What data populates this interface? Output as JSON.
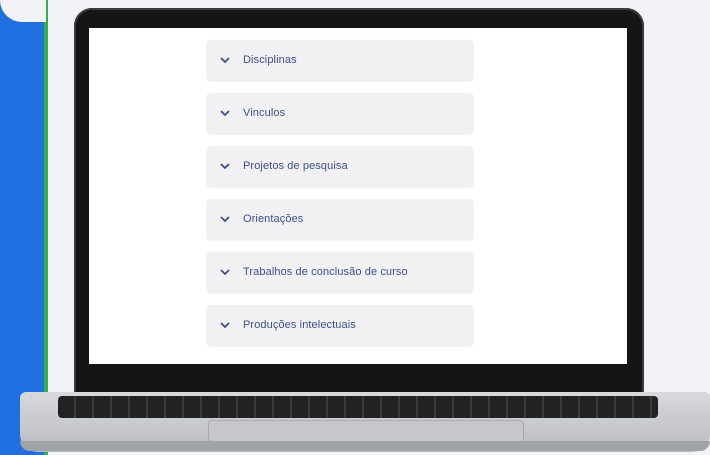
{
  "accordion": {
    "items": [
      {
        "label": "Disciplinas"
      },
      {
        "label": "Vinculos"
      },
      {
        "label": "Projetos de pesquisa"
      },
      {
        "label": "Orientações"
      },
      {
        "label": "Trabalhos de conclusão de curso"
      },
      {
        "label": "Produções intelectuais"
      }
    ]
  },
  "icons": {
    "chevron": "chevron-down-icon"
  },
  "colors": {
    "accent": "#3d4f8f",
    "panel_blue": "#1f6fe0",
    "panel_green": "#2db34a"
  }
}
